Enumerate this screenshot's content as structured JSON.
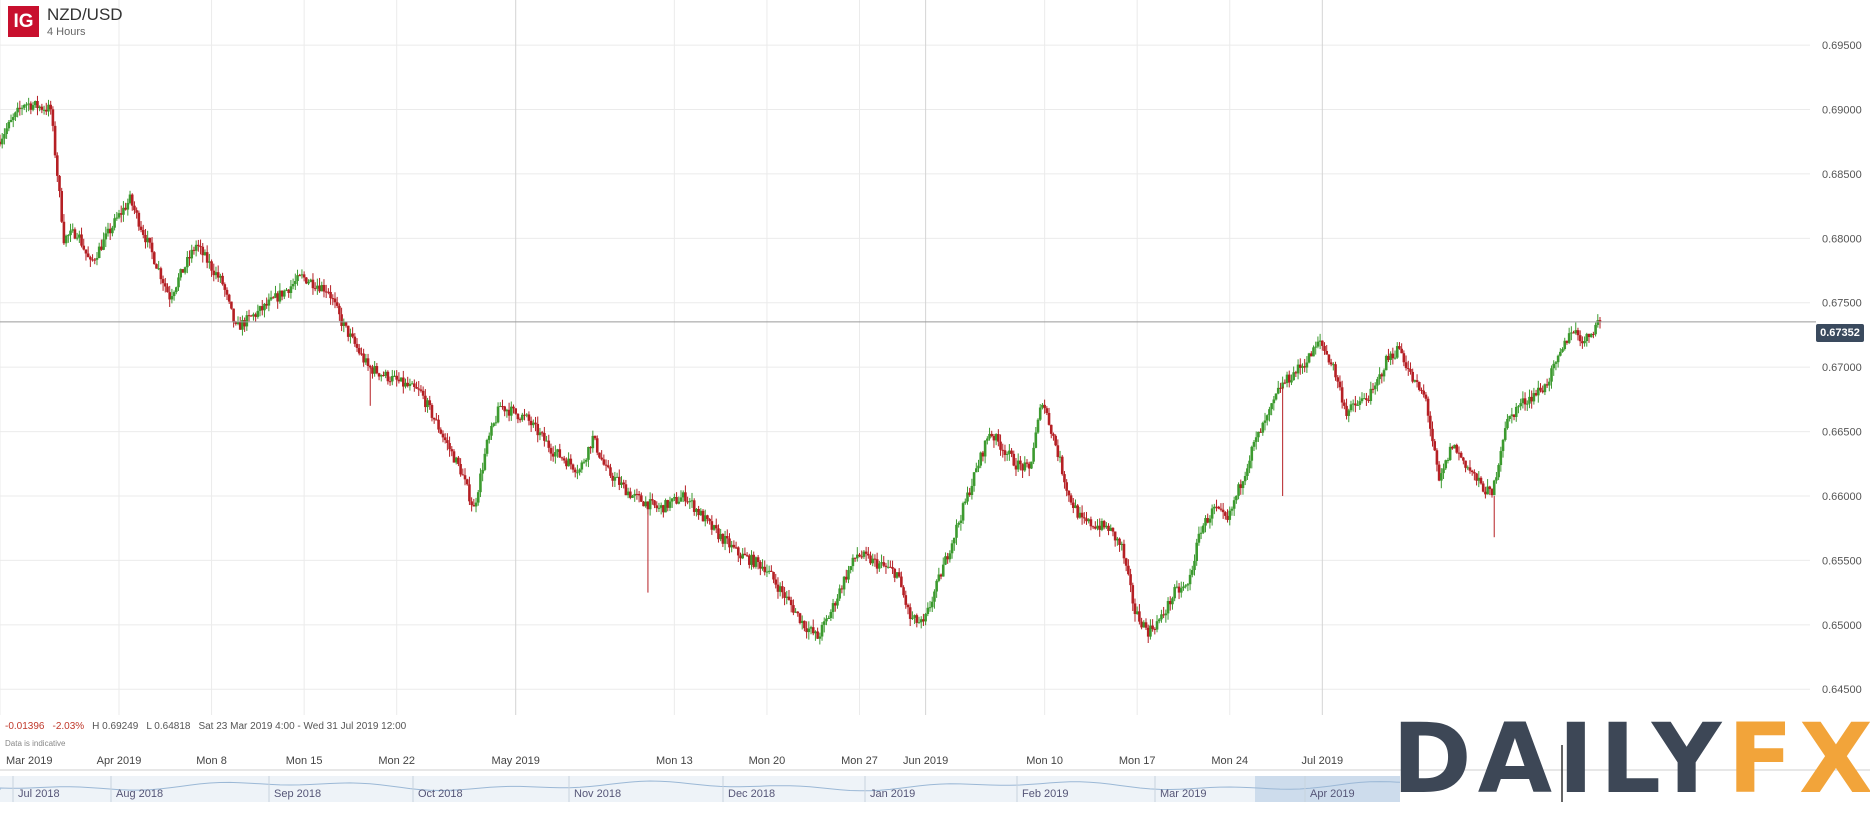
{
  "header": {
    "brand": "IG",
    "symbol": "NZD/USD",
    "timeframe": "4 Hours"
  },
  "stats": {
    "change": "-0.01396",
    "change_pct": "-2.03%",
    "high": "H 0.69249",
    "low": "L 0.64818",
    "range": "Sat 23 Mar 2019 4:00 - Wed 31 Jul 2019 12:00",
    "note": "Data is indicative"
  },
  "watermark": {
    "part1": "DAILY",
    "part2": "FX"
  },
  "colors": {
    "up": "#3c9a2f",
    "down": "#b51f24",
    "grid": "#ebebeb",
    "price_line": "#9a9a9a",
    "tag": "#3a4a5e"
  },
  "chart_data": {
    "type": "candlestick",
    "title": "NZD/USD",
    "ylim": [
      0.643,
      0.6985
    ],
    "y_ticks": [
      "0.69500",
      "0.69000",
      "0.68500",
      "0.68000",
      "0.67500",
      "0.67000",
      "0.66500",
      "0.66000",
      "0.65500",
      "0.65000",
      "0.64500"
    ],
    "current_price": 0.67352,
    "current_price_label": "0.67352",
    "x_labels": [
      {
        "label": "Mar 2019",
        "date": "2019-03-23",
        "major": false
      },
      {
        "label": "Apr 2019",
        "date": "2019-04-01",
        "major": false
      },
      {
        "label": "Mon 8",
        "date": "2019-04-08",
        "major": false
      },
      {
        "label": "Mon 15",
        "date": "2019-04-15",
        "major": false
      },
      {
        "label": "Mon 22",
        "date": "2019-04-22",
        "major": false
      },
      {
        "label": "May 2019",
        "date": "2019-05-01",
        "major": true
      },
      {
        "label": "Mon 13",
        "date": "2019-05-13",
        "major": false
      },
      {
        "label": "Mon 20",
        "date": "2019-05-20",
        "major": false
      },
      {
        "label": "Mon 27",
        "date": "2019-05-27",
        "major": false
      },
      {
        "label": "Jun 2019",
        "date": "2019-06-01",
        "major": true
      },
      {
        "label": "Mon 10",
        "date": "2019-06-10",
        "major": false
      },
      {
        "label": "Mon 17",
        "date": "2019-06-17",
        "major": false
      },
      {
        "label": "Mon 24",
        "date": "2019-06-24",
        "major": false
      },
      {
        "label": "Jul 2019",
        "date": "2019-07-01",
        "major": true
      }
    ],
    "price_path": [
      {
        "date": "2019-03-23",
        "price": 0.6875
      },
      {
        "date": "2019-03-25",
        "price": 0.6905
      },
      {
        "date": "2019-03-27",
        "price": 0.69
      },
      {
        "date": "2019-03-28",
        "price": 0.68
      },
      {
        "date": "2019-03-29",
        "price": 0.6805
      },
      {
        "date": "2019-03-30",
        "price": 0.678
      },
      {
        "date": "2019-04-01",
        "price": 0.6815
      },
      {
        "date": "2019-04-02",
        "price": 0.683
      },
      {
        "date": "2019-04-05",
        "price": 0.6755
      },
      {
        "date": "2019-04-07",
        "price": 0.6795
      },
      {
        "date": "2019-04-09",
        "price": 0.6765
      },
      {
        "date": "2019-04-10",
        "price": 0.673
      },
      {
        "date": "2019-04-12",
        "price": 0.6745
      },
      {
        "date": "2019-04-15",
        "price": 0.677
      },
      {
        "date": "2019-04-17",
        "price": 0.676
      },
      {
        "date": "2019-04-18",
        "price": 0.6735
      },
      {
        "date": "2019-04-20",
        "price": 0.67
      },
      {
        "date": "2019-04-24",
        "price": 0.668
      },
      {
        "date": "2019-04-27",
        "price": 0.662
      },
      {
        "date": "2019-04-28",
        "price": 0.659
      },
      {
        "date": "2019-04-29",
        "price": 0.664
      },
      {
        "date": "2019-04-30",
        "price": 0.667
      },
      {
        "date": "2019-05-02",
        "price": 0.666
      },
      {
        "date": "2019-05-04",
        "price": 0.6635
      },
      {
        "date": "2019-05-06",
        "price": 0.662
      },
      {
        "date": "2019-05-07",
        "price": 0.6645
      },
      {
        "date": "2019-05-08",
        "price": 0.662
      },
      {
        "date": "2019-05-10",
        "price": 0.66
      },
      {
        "date": "2019-05-12",
        "price": 0.659
      },
      {
        "date": "2019-05-14",
        "price": 0.66
      },
      {
        "date": "2019-05-16",
        "price": 0.6575
      },
      {
        "date": "2019-05-18",
        "price": 0.6555
      },
      {
        "date": "2019-05-20",
        "price": 0.6545
      },
      {
        "date": "2019-05-21",
        "price": 0.653
      },
      {
        "date": "2019-05-23",
        "price": 0.65
      },
      {
        "date": "2019-05-24",
        "price": 0.649
      },
      {
        "date": "2019-05-25",
        "price": 0.651
      },
      {
        "date": "2019-05-26",
        "price": 0.6535
      },
      {
        "date": "2019-05-27",
        "price": 0.6555
      },
      {
        "date": "2019-05-30",
        "price": 0.654
      },
      {
        "date": "2019-05-31",
        "price": 0.6505
      },
      {
        "date": "2019-06-01",
        "price": 0.65
      },
      {
        "date": "2019-06-03",
        "price": 0.656
      },
      {
        "date": "2019-06-05",
        "price": 0.662
      },
      {
        "date": "2019-06-06",
        "price": 0.665
      },
      {
        "date": "2019-06-08",
        "price": 0.6625
      },
      {
        "date": "2019-06-09",
        "price": 0.662
      },
      {
        "date": "2019-06-10",
        "price": 0.6675
      },
      {
        "date": "2019-06-11",
        "price": 0.664
      },
      {
        "date": "2019-06-12",
        "price": 0.66
      },
      {
        "date": "2019-06-13",
        "price": 0.658
      },
      {
        "date": "2019-06-15",
        "price": 0.6575
      },
      {
        "date": "2019-06-16",
        "price": 0.656
      },
      {
        "date": "2019-06-17",
        "price": 0.651
      },
      {
        "date": "2019-06-18",
        "price": 0.6495
      },
      {
        "date": "2019-06-19",
        "price": 0.6505
      },
      {
        "date": "2019-06-20",
        "price": 0.6525
      },
      {
        "date": "2019-06-21",
        "price": 0.653
      },
      {
        "date": "2019-06-22",
        "price": 0.6575
      },
      {
        "date": "2019-06-23",
        "price": 0.659
      },
      {
        "date": "2019-06-24",
        "price": 0.658
      },
      {
        "date": "2019-06-25",
        "price": 0.661
      },
      {
        "date": "2019-06-26",
        "price": 0.664
      },
      {
        "date": "2019-06-27",
        "price": 0.666
      },
      {
        "date": "2019-06-28",
        "price": 0.6685
      },
      {
        "date": "2019-06-30",
        "price": 0.6705
      },
      {
        "date": "2019-07-01",
        "price": 0.672
      },
      {
        "date": "2019-07-02",
        "price": 0.67
      },
      {
        "date": "2019-07-03",
        "price": 0.6665
      },
      {
        "date": "2019-07-05",
        "price": 0.668
      },
      {
        "date": "2019-07-06",
        "price": 0.6705
      },
      {
        "date": "2019-07-07",
        "price": 0.6715
      },
      {
        "date": "2019-07-08",
        "price": 0.669
      },
      {
        "date": "2019-07-09",
        "price": 0.6675
      },
      {
        "date": "2019-07-10",
        "price": 0.661
      },
      {
        "date": "2019-07-11",
        "price": 0.664
      },
      {
        "date": "2019-07-12",
        "price": 0.6625
      },
      {
        "date": "2019-07-13",
        "price": 0.661
      },
      {
        "date": "2019-07-14",
        "price": 0.66
      },
      {
        "date": "2019-07-15",
        "price": 0.6655
      },
      {
        "date": "2019-07-16",
        "price": 0.667
      },
      {
        "date": "2019-07-18",
        "price": 0.6685
      },
      {
        "date": "2019-07-19",
        "price": 0.6705
      },
      {
        "date": "2019-07-20",
        "price": 0.673
      },
      {
        "date": "2019-07-21",
        "price": 0.672
      },
      {
        "date": "2019-07-22",
        "price": 0.6735
      }
    ],
    "wicks": [
      {
        "date": "2019-04-20",
        "low": 0.667
      },
      {
        "date": "2019-05-11",
        "low": 0.6525
      },
      {
        "date": "2019-06-28",
        "low": 0.66
      },
      {
        "date": "2019-07-14",
        "low": 0.6568
      }
    ]
  },
  "navigator": {
    "labels": [
      "Jul 2018",
      "Aug 2018",
      "Sep 2018",
      "Oct 2018",
      "Nov 2018",
      "Dec 2018",
      "Jan 2019",
      "Feb 2019",
      "Mar 2019",
      "Apr 2019"
    ]
  }
}
